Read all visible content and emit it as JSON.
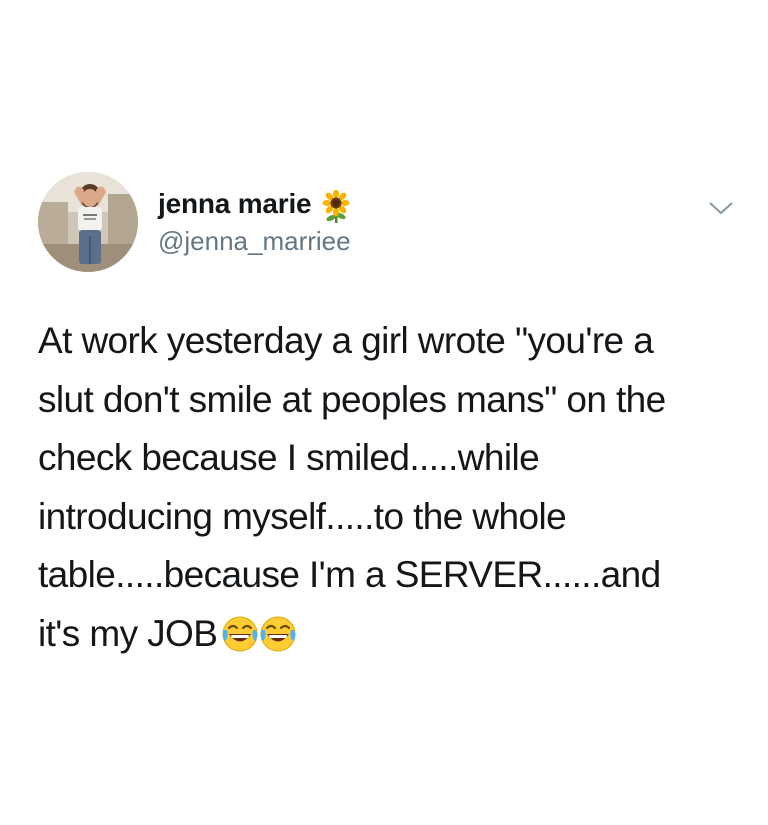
{
  "tweet": {
    "author": {
      "display_name": "jenna marie",
      "handle": "@jenna_marriee",
      "name_emoji": "sunflower-icon",
      "avatar_image": "profile-photo"
    },
    "menu_icon": "chevron-down-icon",
    "text_lines": [
      "At work yesterday a girl wrote \"you're a",
      "slut don't smile at peoples mans\" on the",
      "check because I smiled.....while",
      "introducing myself.....to the whole",
      "table.....because I'm a SERVER......and",
      "it's my JOB"
    ],
    "trailing_emojis": [
      "face-with-tears-of-joy-icon",
      "face-with-tears-of-joy-icon"
    ],
    "colors": {
      "text": "#14171a",
      "handle": "#657786",
      "chevron": "#8899a6",
      "background": "#ffffff"
    }
  }
}
